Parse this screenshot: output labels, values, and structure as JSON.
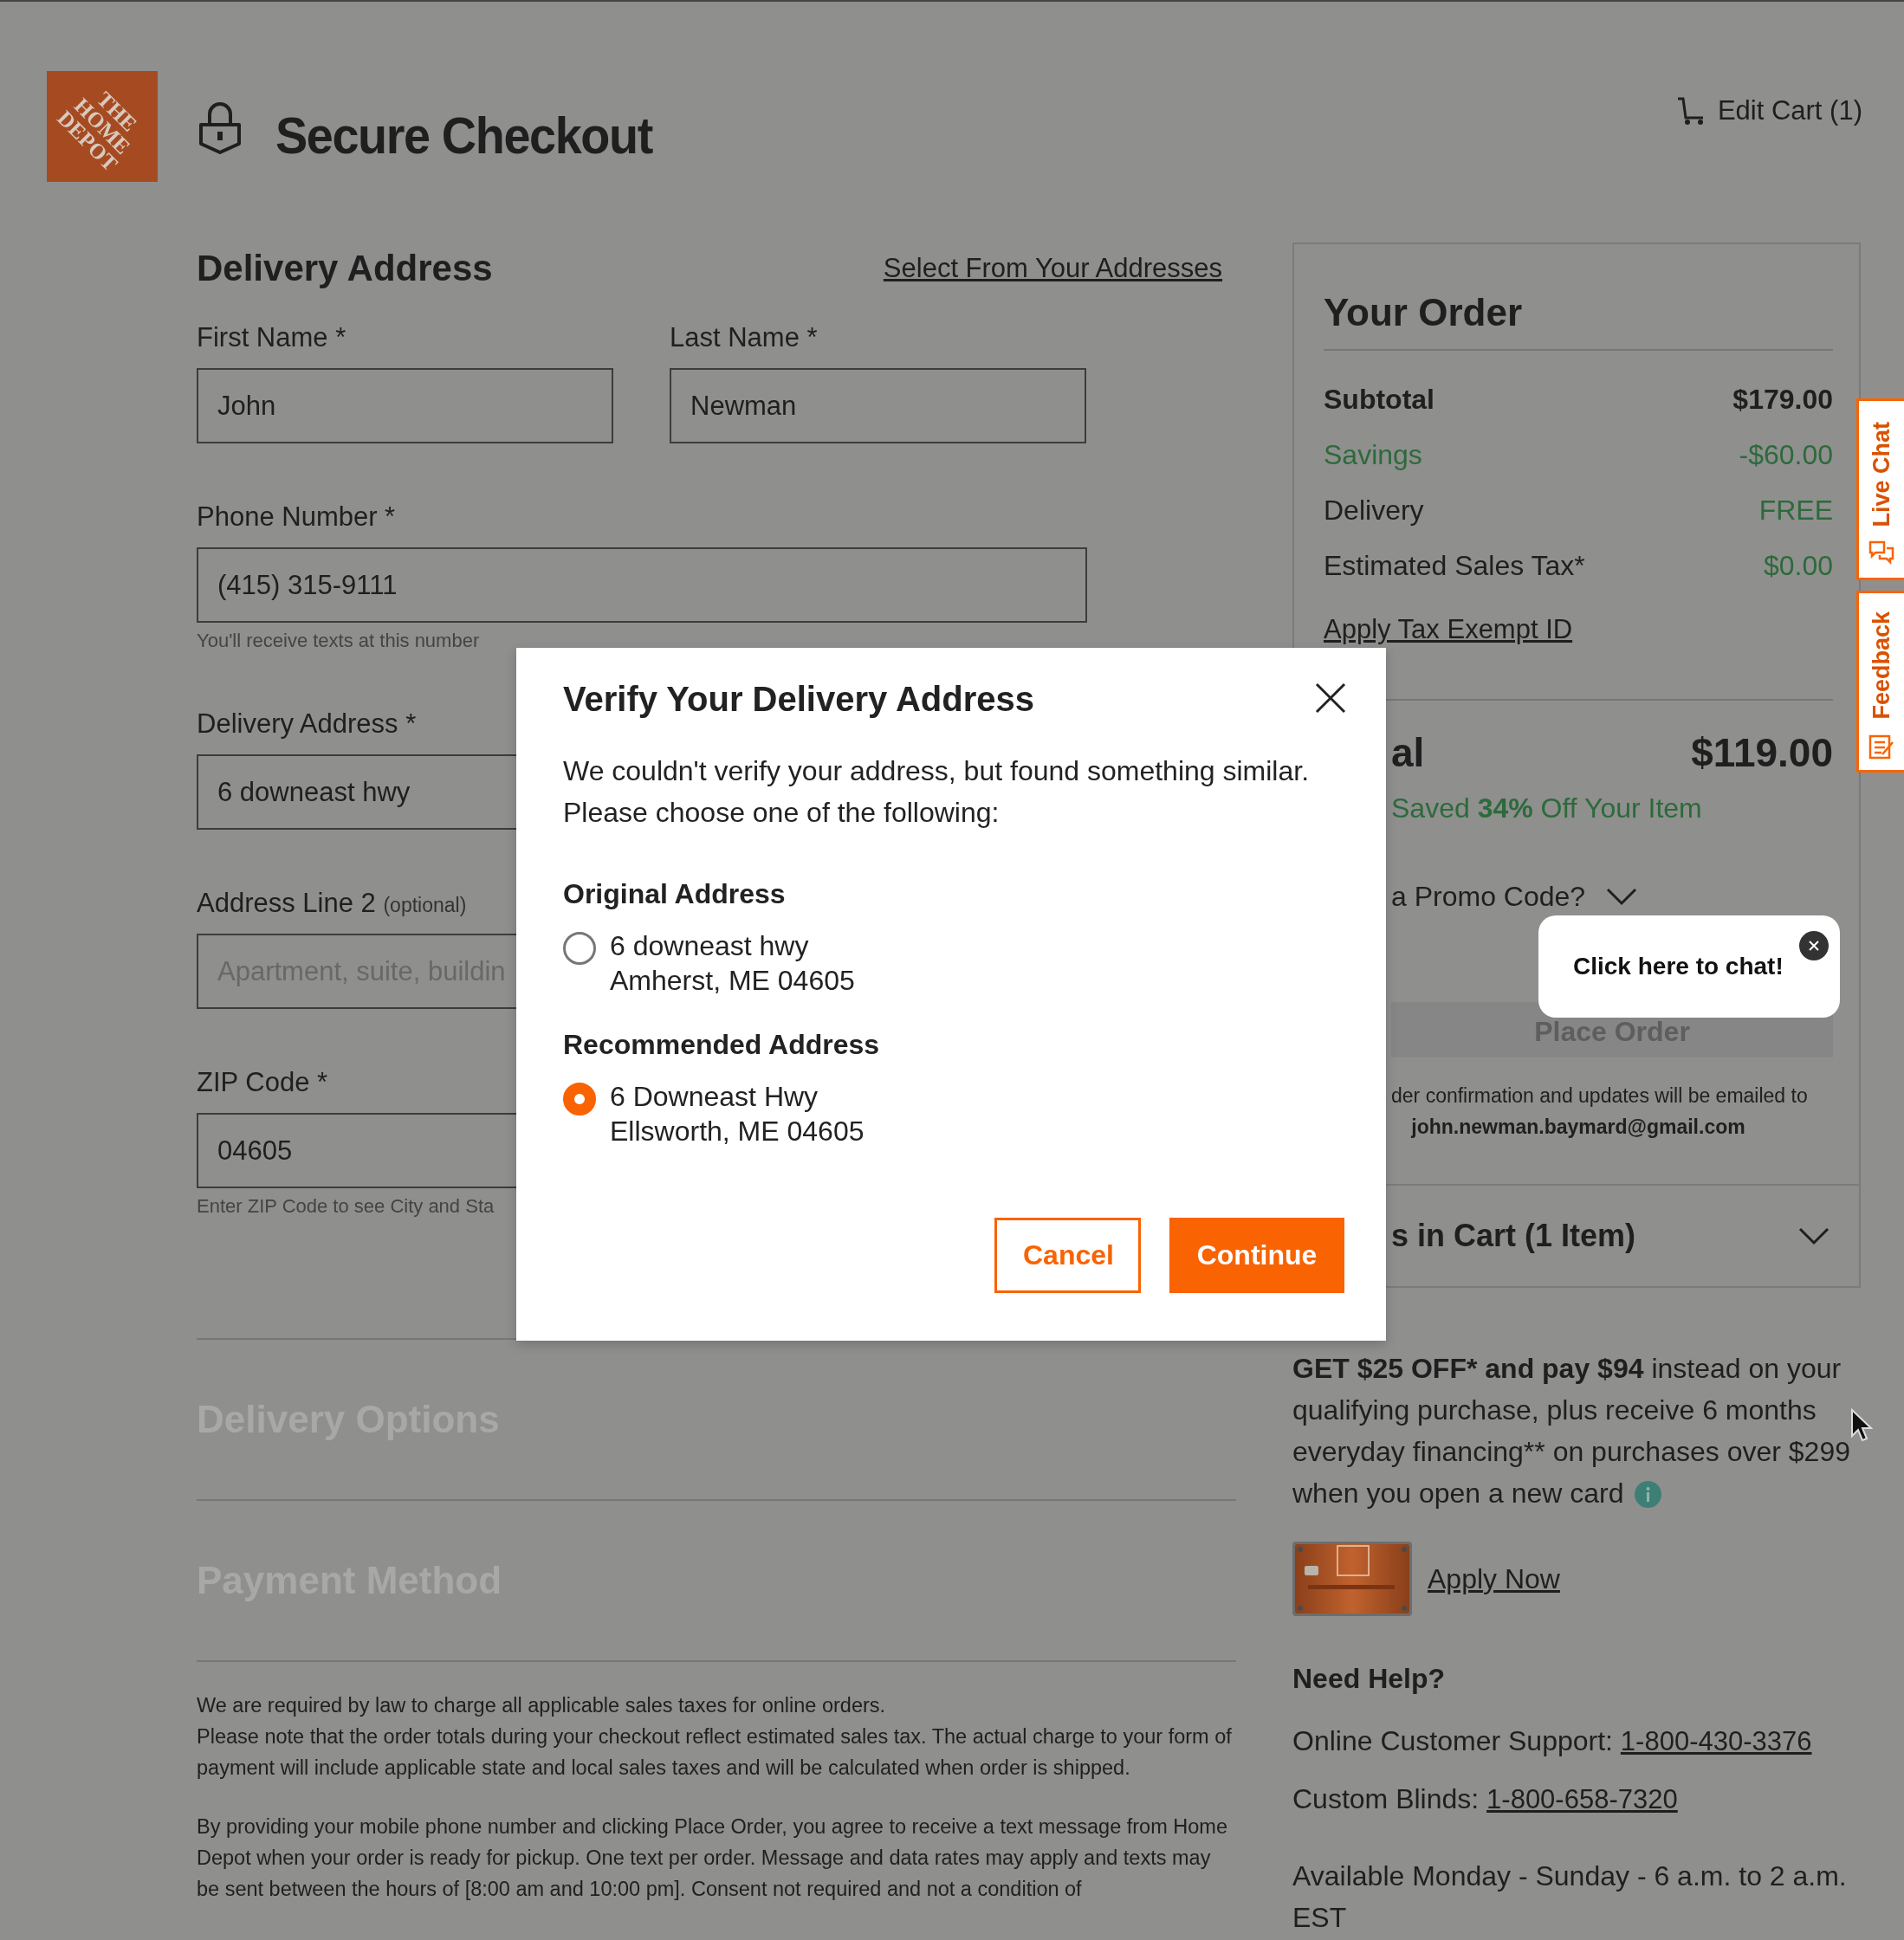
{
  "header": {
    "logo_text": "THE HOME DEPOT",
    "title": "Secure Checkout",
    "cart_link": "Edit Cart (1)"
  },
  "delivery": {
    "heading": "Delivery Address",
    "select_link": "Select From Your Addresses",
    "field_rows": [
      [
        {
          "label": "First Name *",
          "value": "John"
        },
        {
          "label": "Last Name *",
          "value": "Newman"
        }
      ],
      [
        {
          "label": "Phone Number *",
          "value": "(415) 315-9111",
          "hint": "You'll receive texts at this number"
        }
      ],
      [
        {
          "label": "Delivery Address *",
          "value": "6 downeast hwy"
        }
      ],
      [
        {
          "label": "Address Line 2",
          "note": "(optional)",
          "placeholder": "Apartment, suite, buildin"
        }
      ],
      [
        {
          "label": "ZIP Code *",
          "value": "04605",
          "hint": "Enter ZIP Code to see City and Sta"
        }
      ]
    ]
  },
  "sections": [
    {
      "title": "Delivery Options",
      "disabled": true
    },
    {
      "title": "Payment Method",
      "disabled": true
    }
  ],
  "legal": [
    [
      "We are required by law to charge all applicable sales taxes for online orders.",
      "Please note that the order totals during your checkout reflect estimated sales tax. The actual charge to your form of payment will include applicable state and local sales taxes and will be calculated when order is shipped."
    ],
    [
      "By providing your mobile phone number and clicking Place Order, you agree to receive a text message from Home Depot when your order is ready for pickup. One text per order. Message and data rates may apply and texts may be sent between the hours of [8:00 am and 10:00 pm]. Consent not required and not a condition of"
    ]
  ],
  "order": {
    "heading": "Your Order",
    "rows": [
      {
        "label": "Subtotal",
        "value": "$179.00",
        "kind": "bold"
      },
      {
        "label": "Savings",
        "value": "-$60.00",
        "kind": "savings"
      },
      {
        "label": "Delivery",
        "value": "FREE",
        "kind": "free"
      },
      {
        "label": "Estimated Sales Tax*",
        "value": "$0.00",
        "kind": "free"
      }
    ],
    "tax_link": "Apply Tax Exempt ID",
    "total_label": "al",
    "total": "$119.00",
    "saved": "Saved **34%** Off Your Item",
    "promo": "a Promo Code?",
    "place_order": {
      "label": "Place Order",
      "disabled": true
    },
    "confirmation": "der confirmation and updates will be emailed to",
    "email": "john.newman.baymard@gmail.com"
  },
  "cart_summary": "s in Cart (1 Item)",
  "offer": {
    "bold": "GET $25 OFF* and pay $94",
    "text": " instead on your qualifying purchase, plus receive 6 months everyday financing** on purchases over $299 when you open a new card",
    "apply": "Apply Now"
  },
  "help": {
    "heading": "Need Help?",
    "lines": [
      {
        "label": "Online Customer Support:",
        "phone": "1-800-430-3376"
      },
      {
        "label": "Custom Blinds:",
        "phone": "1-800-658-7320"
      }
    ],
    "hours": "Available Monday - Sunday - 6 a.m. to 2 a.m. EST"
  },
  "modal": {
    "title": "Verify Your Delivery Address",
    "message": "We couldn't verify your address, but found something similar. Please choose one of the following:",
    "options": [
      {
        "heading": "Original Address",
        "lines": [
          "6 downeast hwy",
          "Amherst, ME 04605"
        ],
        "selected": false
      },
      {
        "heading": "Recommended Address",
        "lines": [
          "6 Downeast Hwy",
          "Ellsworth, ME 04605"
        ],
        "selected": true
      }
    ],
    "buttons": [
      {
        "label": "Cancel",
        "kind": "secondary"
      },
      {
        "label": "Continue",
        "kind": "primary"
      }
    ]
  },
  "chat_bubble": "Click here to chat!",
  "side_tabs": [
    {
      "label": "Live Chat",
      "kind": "chat"
    },
    {
      "label": "Feedback",
      "kind": "feedback"
    }
  ]
}
